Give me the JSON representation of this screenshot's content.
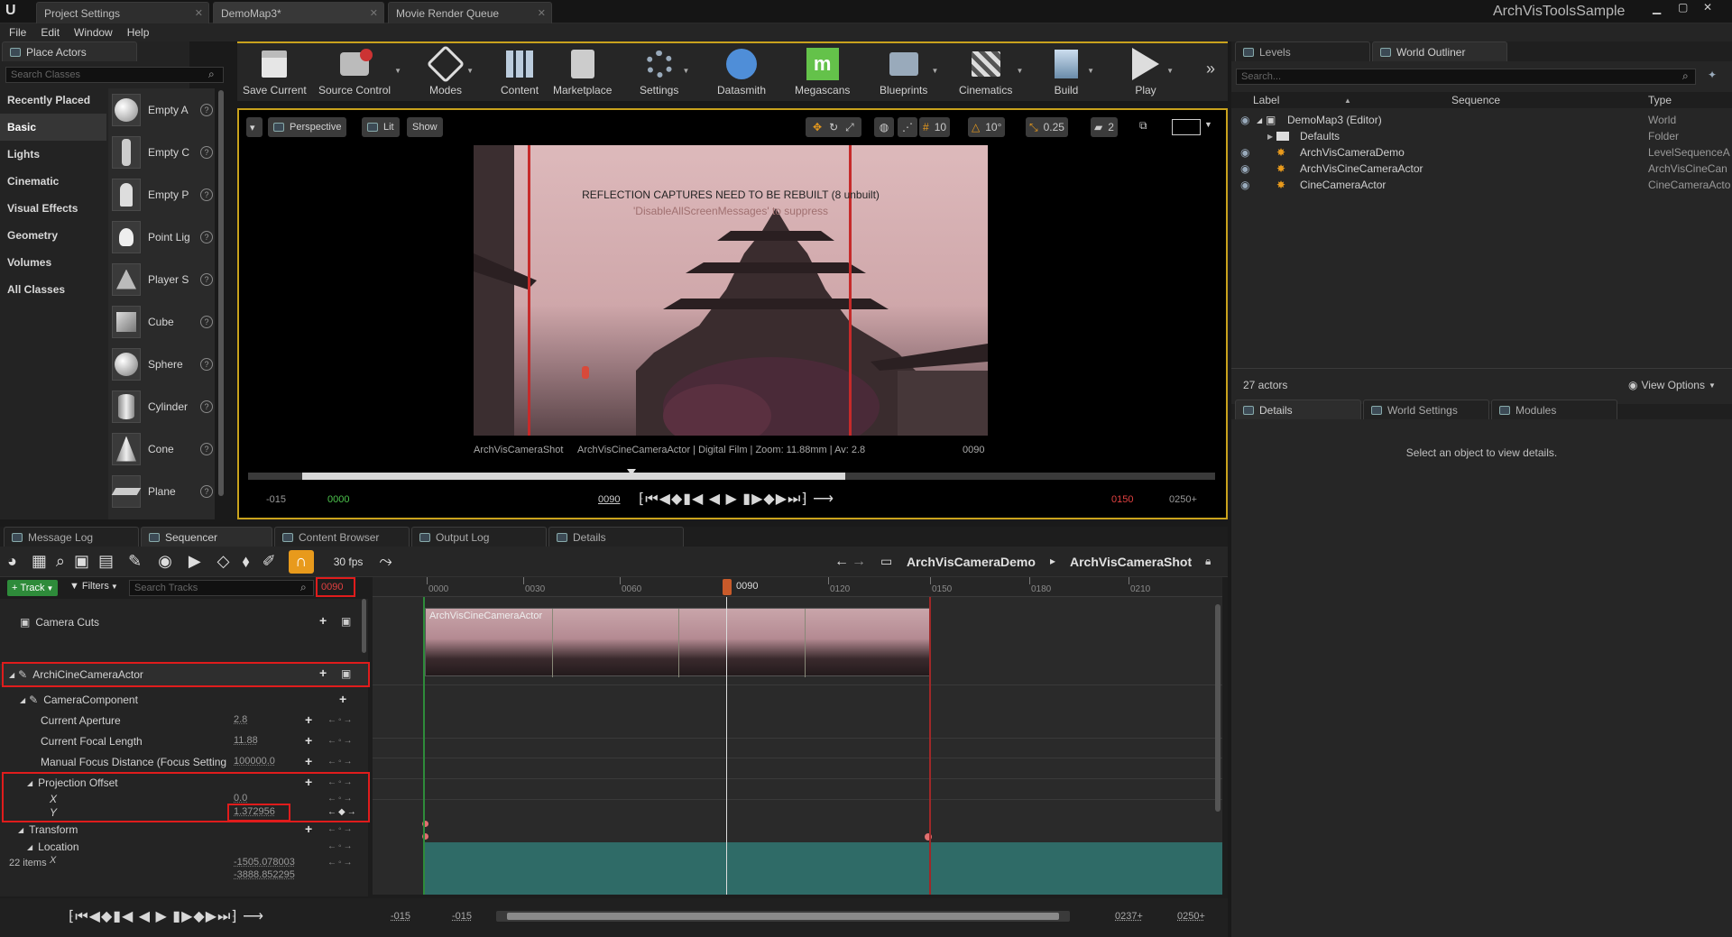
{
  "titlebar": {
    "tabs": [
      "Project Settings",
      "DemoMap3*",
      "Movie Render Queue"
    ],
    "project_name": "ArchVisToolsSample"
  },
  "menu": [
    "File",
    "Edit",
    "Window",
    "Help"
  ],
  "place_actors": {
    "tab": "Place Actors",
    "search_placeholder": "Search Classes",
    "categories": [
      "Recently Placed",
      "Basic",
      "Lights",
      "Cinematic",
      "Visual Effects",
      "Geometry",
      "Volumes",
      "All Classes"
    ],
    "active_category": "Basic",
    "items": [
      "Empty A",
      "Empty C",
      "Empty P",
      "Point Lig",
      "Player S",
      "Cube",
      "Sphere",
      "Cylinder",
      "Cone",
      "Plane"
    ]
  },
  "toolbar": {
    "buttons": [
      "Save Current",
      "Source Control",
      "Modes",
      "Content",
      "Marketplace",
      "Settings",
      "Datasmith",
      "Megascans",
      "Blueprints",
      "Cinematics",
      "Build",
      "Play"
    ]
  },
  "viewport": {
    "perspective": "Perspective",
    "lit": "Lit",
    "show": "Show",
    "grid_snap": "10",
    "rot_snap": "10°",
    "scale_snap": "0.25",
    "cam_speed": "2",
    "msg_line1": "REFLECTION CAPTURES NEED TO BE REBUILT (8 unbuilt)",
    "msg_line2": "'DisableAllScreenMessages' to suppress",
    "info_left": "ArchVisCameraShot",
    "info_mid": "ArchVisCineCameraActor | Digital Film | Zoom: 11.88mm | Av: 2.8",
    "info_frame": "0090",
    "time_start_outer": "-015",
    "time_start": "0000",
    "time_current": "0090",
    "time_end": "0150",
    "time_end_outer": "0250+"
  },
  "outliner": {
    "tabs": [
      "Levels",
      "World Outliner"
    ],
    "search_placeholder": "Search...",
    "col_label": "Label",
    "col_sequence": "Sequence",
    "col_type": "Type",
    "rows": [
      {
        "label": "DemoMap3 (Editor)",
        "type": "World"
      },
      {
        "label": "Defaults",
        "type": "Folder"
      },
      {
        "label": "ArchVisCameraDemo",
        "type": "LevelSequenceA"
      },
      {
        "label": "ArchVisCineCameraActor",
        "type": "ArchVisCineCan"
      },
      {
        "label": "CineCameraActor",
        "type": "CineCameraActo"
      }
    ],
    "actor_count": "27 actors",
    "view_options": "View Options"
  },
  "details": {
    "tabs": [
      "Details",
      "World Settings",
      "Modules"
    ],
    "empty_msg": "Select an object to view details."
  },
  "bottom_tabs": [
    "Message Log",
    "Sequencer",
    "Content Browser",
    "Output Log",
    "Details"
  ],
  "sequencer": {
    "fps": "30 fps",
    "breadcrumb_1": "ArchVisCameraDemo",
    "breadcrumb_2": "ArchVisCameraShot",
    "track_button": "Track",
    "filters_button": "Filters",
    "search_placeholder": "Search Tracks",
    "current_frame": "0090",
    "playhead_label": "0090",
    "ruler_ticks": [
      "0000",
      "0030",
      "0060",
      "0120",
      "0150",
      "0180",
      "0210"
    ],
    "camera_cuts": "Camera Cuts",
    "shot_label": "ArchVisCineCameraActor",
    "actor": "ArchiCineCameraActor",
    "component": "CameraComponent",
    "tracks": [
      {
        "name": "Current Aperture",
        "value": "2.8"
      },
      {
        "name": "Current Focal Length",
        "value": "11.88"
      },
      {
        "name": "Manual Focus Distance (Focus Setting",
        "value": "100000.0"
      }
    ],
    "projection_offset": "Projection Offset",
    "x_label": "X",
    "x_value": "0.0",
    "y_label": "Y",
    "y_value": "1.372956",
    "transform": "Transform",
    "location": "Location",
    "loc_x_label": "X",
    "loc_x_value": "-1505.078003",
    "loc_y_value": "-3888.852295",
    "items_count": "22 items",
    "bottom_start_outer": "-015",
    "bottom_start": "-015",
    "bottom_end": "0237+",
    "bottom_end_outer": "0250+"
  },
  "colors": {
    "accent_gold": "#c9a21d",
    "highlight_red": "#e01c1c",
    "track_teal": "#2f6b67",
    "add_track_green": "#2e8b3a"
  }
}
